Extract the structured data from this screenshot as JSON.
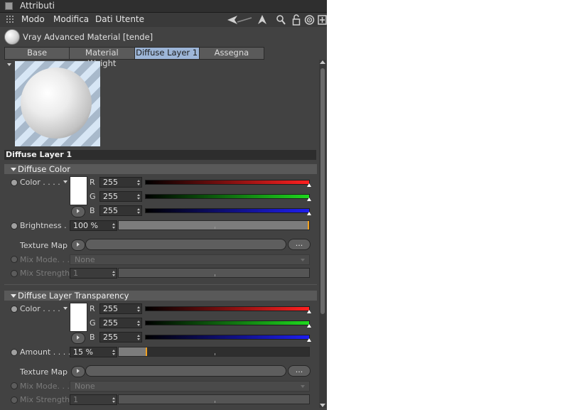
{
  "window": {
    "title": "Attributi"
  },
  "menu": {
    "items": [
      "Modo",
      "Modifica",
      "Dati Utente"
    ]
  },
  "toolbar": {
    "icons": [
      "back-arrow-icon",
      "up-arrow-icon",
      "search-icon",
      "lock-icon",
      "target-icon",
      "new-panel-icon"
    ]
  },
  "material": {
    "title": "Vray Advanced Material [tende]"
  },
  "tabs": [
    {
      "label": "Base",
      "active": false
    },
    {
      "label": "Material Weight",
      "active": false
    },
    {
      "label": "Diffuse Layer 1",
      "active": true
    },
    {
      "label": "Assegna",
      "active": false
    }
  ],
  "colors": {
    "active_tab": "#9db6d8",
    "panel": "#424242",
    "accent": "#f0a020"
  },
  "section": {
    "title": "Diffuse Layer 1"
  },
  "diffuse_color": {
    "title": "Diffuse Color",
    "color_label": "Color . . . .",
    "r_label": "R",
    "r": "255",
    "g_label": "G",
    "g": "255",
    "b_label": "B",
    "b": "255",
    "brightness_label": "Brightness . .",
    "brightness": "100 %",
    "brightness_level": 1.0,
    "texture_label": "Texture Map",
    "texture_btn": "...",
    "mixmode_label": "Mix Mode. . .",
    "mixmode_value": "None",
    "mixstrength_label": "Mix Strength",
    "mixstrength_value": "1"
  },
  "transparency": {
    "title": "Diffuse Layer Transparency",
    "color_label": "Color . . . .",
    "r_label": "R",
    "r": "255",
    "g_label": "G",
    "g": "255",
    "b_label": "B",
    "b": "255",
    "amount_label": "Amount . . . .",
    "amount": "15 %",
    "amount_level": 0.15,
    "texture_label": "Texture Map",
    "texture_btn": "...",
    "mixmode_label": "Mix Mode. . .",
    "mixmode_value": "None",
    "mixstrength_label": "Mix Strength",
    "mixstrength_value": "1"
  }
}
